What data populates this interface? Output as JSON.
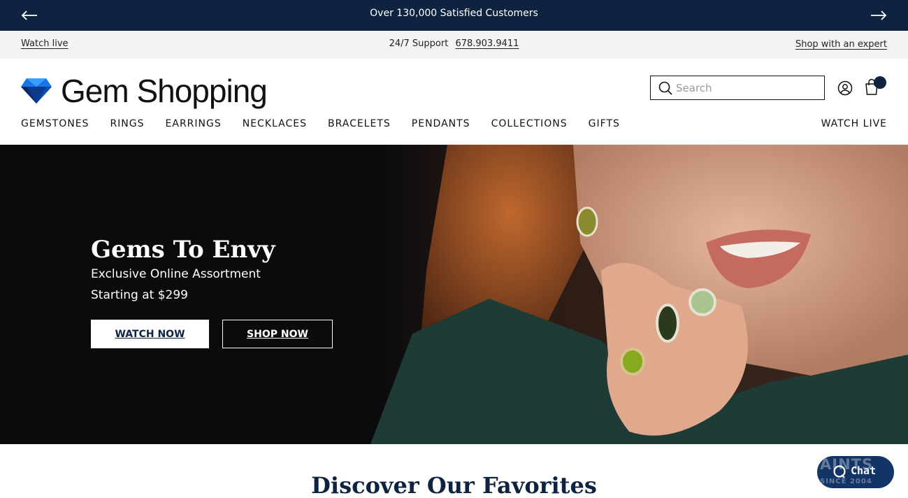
{
  "announcement": {
    "message": "Over 130,000 Satisfied Customers"
  },
  "utility": {
    "watch_live": "Watch live",
    "support_label": "24/7 Support",
    "support_phone": "678.903.9411",
    "expert_link": "Shop with an expert"
  },
  "header": {
    "brand_name": "Gem Shopping",
    "search_placeholder": "Search",
    "icons": [
      "arrow-left-icon",
      "arrow-right-icon",
      "gem-logo-icon",
      "search-icon",
      "account-icon",
      "cart-icon",
      "chat-icon"
    ]
  },
  "nav": {
    "items": [
      "GEMSTONES",
      "RINGS",
      "EARRINGS",
      "NECKLACES",
      "BRACELETS",
      "PENDANTS",
      "COLLECTIONS",
      "GIFTS"
    ],
    "right": "WATCH LIVE"
  },
  "hero": {
    "title": "Gems To Envy",
    "subtitle": "Exclusive Online Assortment",
    "price_line": "Starting at $299",
    "primary_cta": "WATCH NOW",
    "secondary_cta": "SHOP NOW"
  },
  "section": {
    "title": "Discover Our Favorites"
  },
  "chat": {
    "label": "Chat",
    "ghost_top": "AINTS",
    "ghost_bottom": "SINCE 2004"
  },
  "colors": {
    "navy": "#0e2340",
    "chat": "#123466",
    "utility_bg": "#f3f3f3",
    "hero_bg": "#0b0b0d"
  }
}
